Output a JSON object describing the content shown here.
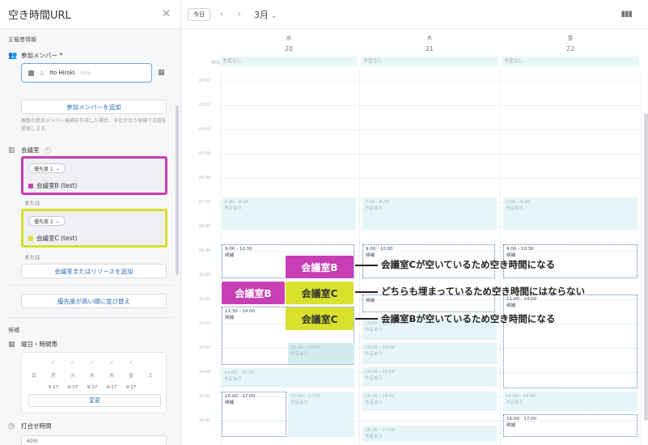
{
  "sidebar": {
    "title": "空き時間URL",
    "organizer_section": "主催者情報",
    "members_label": "参加メンバー *",
    "member_name": "Ito Hiroki",
    "member_tag": "(自分)",
    "add_member_label": "参加メンバーを追加",
    "hint": "複数の参加メンバー候補を作成した場合、予定が合う候補で日程を提案します。",
    "room_label": "会議室",
    "room_help": "?",
    "rooms": [
      {
        "priority": "優先度 1",
        "name": "会議室B (test)",
        "color": "#c83fb5"
      },
      {
        "priority": "優先度 2",
        "name": "会議室C (test)",
        "color": "#d7e02c"
      }
    ],
    "or_label": "または",
    "add_room_label": "会議室またはリソースを追加",
    "sort_label": "優先度が高い順に並び替え",
    "candidate_section": "候補",
    "weekday_label": "曜日・時間帯",
    "days": [
      {
        "name": "日",
        "checked": false,
        "time": ""
      },
      {
        "name": "月",
        "checked": true,
        "time": "9-17"
      },
      {
        "name": "火",
        "checked": true,
        "time": "9-17"
      },
      {
        "name": "水",
        "checked": true,
        "time": "9-17"
      },
      {
        "name": "木",
        "checked": true,
        "time": "9-17"
      },
      {
        "name": "金",
        "checked": true,
        "time": "9-17"
      },
      {
        "name": "土",
        "checked": false,
        "time": ""
      }
    ],
    "change_label": "変更",
    "meeting_time_label": "打合せ時間",
    "duration_value": "60分"
  },
  "calendar": {
    "today_label": "今日",
    "month_label": "3月",
    "days": [
      {
        "weekday": "水",
        "date": "20"
      },
      {
        "weekday": "木",
        "date": "21"
      },
      {
        "weekday": "金",
        "date": "22"
      }
    ],
    "allday_label": "終日",
    "allday_text": "予定なし",
    "hours": [
      "02:00",
      "03:00",
      "04:00",
      "05:00",
      "06:00",
      "07:00",
      "08:00",
      "09:00",
      "10:00",
      "11:00",
      "12:00",
      "13:00",
      "14:00",
      "15:00",
      "16:00"
    ],
    "event_busy": "予定あり",
    "candidate_label": "候補",
    "events": {
      "am": "7:00 - 8:30",
      "am_thu": "7:00 - 8:30",
      "am_fri": "7:00 - 8:30",
      "wed_c1": "9:00 - 10:30",
      "wed_c2": "11:30 - 14:00",
      "wed_e1": "13:00 - 14:00",
      "wed_e2": "14:00 - 15:00",
      "wed_e3": "15:00 - 17:00",
      "wed_c3": "15:00 - 17:00",
      "thu_c1": "9:00 - 10:00",
      "thu_e1": "11:00 - 12:00",
      "thu_e2": "13:00 - 14:00",
      "thu_e3": "14:00 - 15:00",
      "thu_e4": "15:00 - 16:00",
      "thu_e5": "16:30 - 17:00",
      "fri_c1": "9:00 - 10:30",
      "fri_c2": "11:00 - 14:00",
      "fri_e1": "15:00 - 16:00",
      "fri_c3": "16:00 - 17:00"
    }
  },
  "annotations": {
    "room_b": "会議室B",
    "room_c": "会議室C",
    "note1": "会議室Cが空いているため空き時間になる",
    "note2": "どちらも埋まっているため空き時間にはならない",
    "note3": "会議室Bが空いているため空き時間になる"
  }
}
